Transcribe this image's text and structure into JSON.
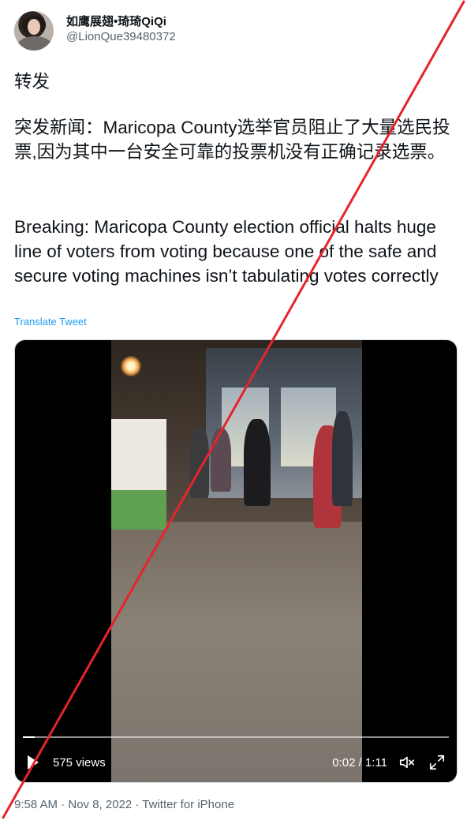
{
  "author": {
    "display_name": "如鹰展翅•琦琦QiQi",
    "handle": "@LionQue39480372"
  },
  "tweet": {
    "label": "转发",
    "text_zh": "突发新闻：Maricopa County选举官员阻止了大量选民投票,因为其中一台安全可靠的投票机没有正确记录选票。",
    "text_en": "Breaking: Maricopa County election official halts huge line of voters from voting because one of the safe and secure voting machines isn’t tabulating votes correctly",
    "translate_label": "Translate Tweet"
  },
  "video": {
    "views": "575 views",
    "time": "0:02 / 1:11",
    "progress": 0.028
  },
  "meta": {
    "timestamp": "9:58 AM · Nov 8, 2022 · Twitter for iPhone"
  },
  "colors": {
    "link": "#1d9bf0",
    "secondary_text": "#536471",
    "overlay_line": "#e8232b"
  }
}
